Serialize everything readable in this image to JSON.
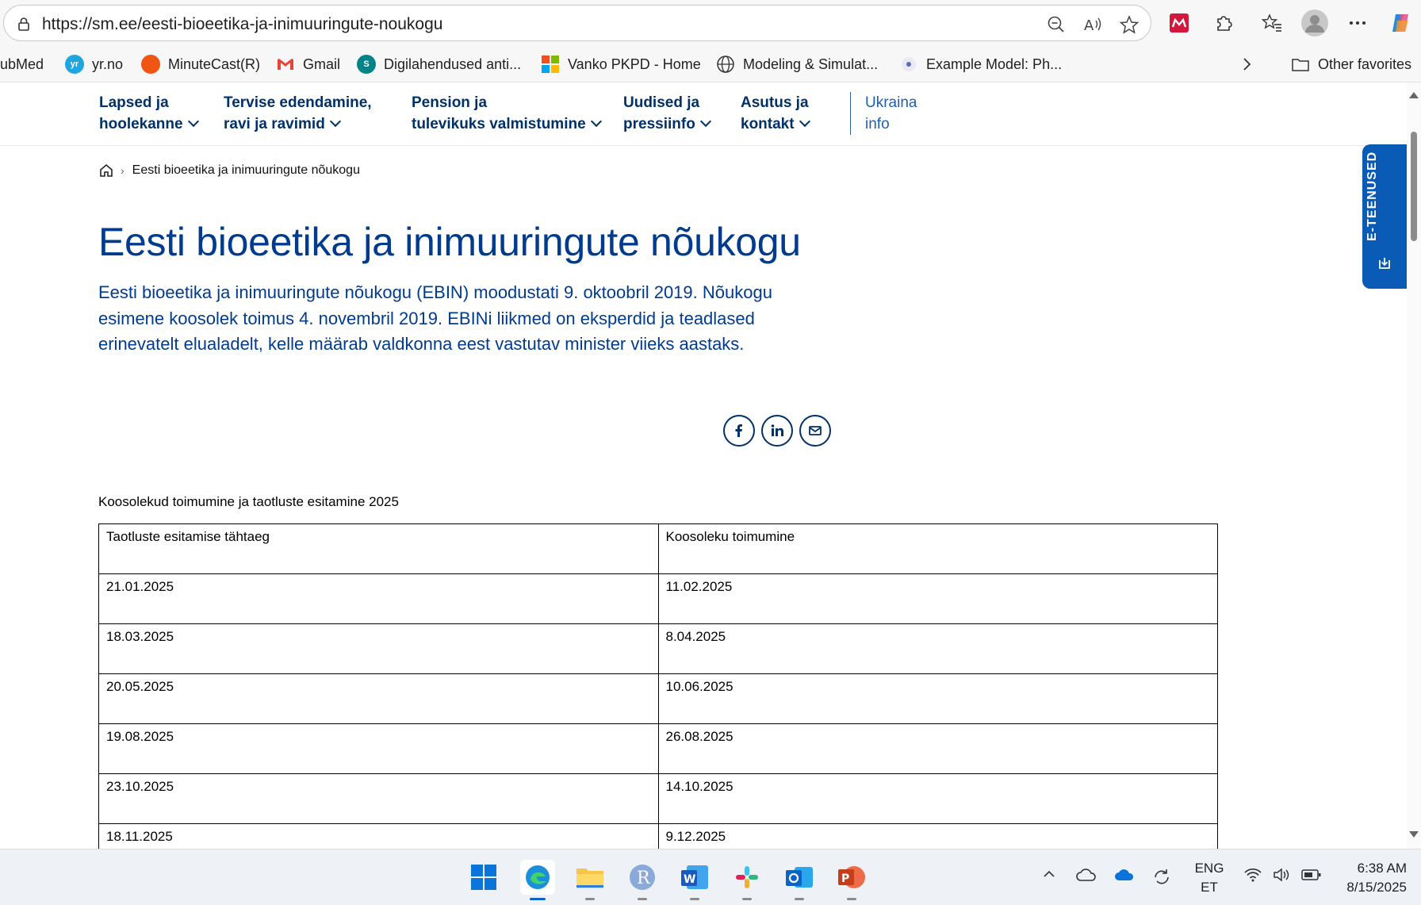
{
  "browser": {
    "url": "https://sm.ee/eesti-bioeetika-ja-inimuuringute-noukogu",
    "favorites": [
      {
        "label": "ubMed",
        "icon": "pubmed-icon"
      },
      {
        "label": "yr.no",
        "icon": "yr-icon"
      },
      {
        "label": "MinuteCast(R)",
        "icon": "accuweather-icon"
      },
      {
        "label": "Gmail",
        "icon": "gmail-icon"
      },
      {
        "label": "Digilahendused anti...",
        "icon": "sharepoint-icon"
      },
      {
        "label": "Vanko PKPD - Home",
        "icon": "microsoft-icon"
      },
      {
        "label": "Modeling & Simulat...",
        "icon": "globe-icon"
      },
      {
        "label": "Example Model: Ph...",
        "icon": "model-icon"
      }
    ],
    "other_favorites": "Other favorites"
  },
  "site_nav": {
    "items": [
      {
        "line1": "Lapsed ja",
        "line2": "hoolekanne"
      },
      {
        "line1": "Tervise edendamine,",
        "line2": "ravi ja ravimid"
      },
      {
        "line1": "Pension ja",
        "line2": "tulevikuks valmistumine"
      },
      {
        "line1": "Uudised ja",
        "line2": "pressiinfo"
      },
      {
        "line1": "Asutus ja",
        "line2": "kontakt"
      }
    ],
    "ukraina": {
      "line1": "Ukraina",
      "line2": "info"
    }
  },
  "breadcrumb": {
    "current": "Eesti bioeetika ja inimuuringute nõukogu"
  },
  "page": {
    "title": "Eesti bioeetika ja inimuuringute nõukogu",
    "intro": "Eesti bioeetika ja inimuuringute nõukogu (EBIN) moodustati 9. oktoobril 2019. Nõukogu esimene koosolek toimus 4. novembril 2019. EBINi liikmed on eksperdid ja teadlased erinevatelt elualadelt, kelle määrab valdkonna eest vastutav minister viieks aastaks."
  },
  "e_tab": {
    "label": "E-TEENUSED"
  },
  "table": {
    "caption": "Koosolekud toimumine ja taotluste esitamine 2025",
    "headers": [
      "Taotluste esitamise tähtaeg",
      "Koosoleku toimumine"
    ],
    "rows": [
      [
        "21.01.2025",
        "11.02.2025"
      ],
      [
        "18.03.2025",
        "8.04.2025"
      ],
      [
        "20.05.2025",
        "10.06.2025"
      ],
      [
        "19.08.2025",
        "26.08.2025"
      ],
      [
        "23.10.2025",
        "14.10.2025"
      ],
      [
        "18.11.2025",
        "9.12.2025"
      ]
    ]
  },
  "taskbar": {
    "lang_line1": "ENG",
    "lang_line2": "ET",
    "time": "6:38 AM",
    "date": "8/15/2025"
  },
  "colors": {
    "brand": "#003b8e",
    "nav": "#003168",
    "e_tab": "#0a5bb5"
  }
}
